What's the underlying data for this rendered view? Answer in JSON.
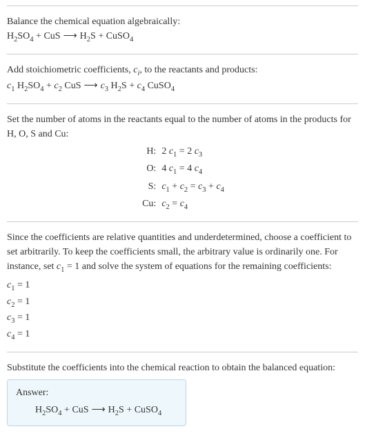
{
  "section1": {
    "title": "Balance the chemical equation algebraically:",
    "equation": {
      "r1": "H",
      "r1s1": "2",
      "r1b": "SO",
      "r1s2": "4",
      "plus1": " + ",
      "r2": "CuS",
      "arrow": " ⟶ ",
      "p1": "H",
      "p1s1": "2",
      "p1b": "S",
      "plus2": " + ",
      "p2": "CuSO",
      "p2s1": "4"
    }
  },
  "section2": {
    "title_a": "Add stoichiometric coefficients, ",
    "title_ci": "c",
    "title_ci_sub": "i",
    "title_b": ", to the reactants and products:",
    "equation": {
      "c1": "c",
      "c1s": "1",
      "sp1": " ",
      "r1": "H",
      "r1s1": "2",
      "r1b": "SO",
      "r1s2": "4",
      "plus1": " + ",
      "c2": "c",
      "c2s": "2",
      "sp2": " ",
      "r2": "CuS",
      "arrow": " ⟶ ",
      "c3": "c",
      "c3s": "3",
      "sp3": " ",
      "p1": "H",
      "p1s1": "2",
      "p1b": "S",
      "plus2": " + ",
      "c4": "c",
      "c4s": "4",
      "sp4": " ",
      "p2": "CuSO",
      "p2s1": "4"
    }
  },
  "section3": {
    "title": "Set the number of atoms in the reactants equal to the number of atoms in the products for H, O, S and Cu:",
    "rows": [
      {
        "label": "H:",
        "lhs_a": "2 ",
        "lhs_c": "c",
        "lhs_s": "1",
        "eq": " = ",
        "rhs_a": "2 ",
        "rhs_c": "c",
        "rhs_s": "3"
      },
      {
        "label": "O:",
        "lhs_a": "4 ",
        "lhs_c": "c",
        "lhs_s": "1",
        "eq": " = ",
        "rhs_a": "4 ",
        "rhs_c": "c",
        "rhs_s": "4"
      },
      {
        "label": "S:",
        "lhs_a": "",
        "lhs_c": "c",
        "lhs_s": "1",
        "mid": " + ",
        "lhs2_c": "c",
        "lhs2_s": "2",
        "eq": " = ",
        "rhs_c": "c",
        "rhs_s": "3",
        "mid2": " + ",
        "rhs2_c": "c",
        "rhs2_s": "4"
      },
      {
        "label": "Cu:",
        "lhs_c": "c",
        "lhs_s": "2",
        "eq": " = ",
        "rhs_c": "c",
        "rhs_s": "4"
      }
    ]
  },
  "section4": {
    "text_a": "Since the coefficients are relative quantities and underdetermined, choose a coefficient to set arbitrarily. To keep the coefficients small, the arbitrary value is ordinarily one. For instance, set ",
    "set_c": "c",
    "set_s": "1",
    "set_eq": " = 1",
    "text_b": " and solve the system of equations for the remaining coefficients:",
    "coefs": [
      {
        "c": "c",
        "s": "1",
        "v": " = 1"
      },
      {
        "c": "c",
        "s": "2",
        "v": " = 1"
      },
      {
        "c": "c",
        "s": "3",
        "v": " = 1"
      },
      {
        "c": "c",
        "s": "4",
        "v": " = 1"
      }
    ]
  },
  "section5": {
    "title": "Substitute the coefficients into the chemical reaction to obtain the balanced equation:",
    "answer_label": "Answer:",
    "equation": {
      "r1": "H",
      "r1s1": "2",
      "r1b": "SO",
      "r1s2": "4",
      "plus1": " + ",
      "r2": "CuS",
      "arrow": " ⟶ ",
      "p1": "H",
      "p1s1": "2",
      "p1b": "S",
      "plus2": " + ",
      "p2": "CuSO",
      "p2s1": "4"
    }
  }
}
